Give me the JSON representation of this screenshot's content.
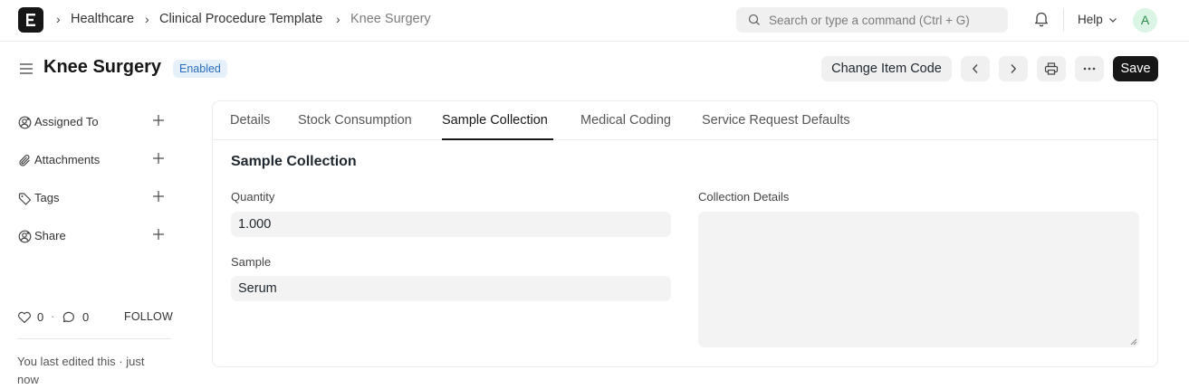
{
  "navbar": {
    "breadcrumbs": [
      "Healthcare",
      "Clinical Procedure Template",
      "Knee Surgery"
    ],
    "search_placeholder": "Search or type a command (Ctrl + G)",
    "help_label": "Help",
    "avatar_initial": "A"
  },
  "page": {
    "title": "Knee Surgery",
    "status": "Enabled",
    "change_item_code_label": "Change Item Code",
    "save_label": "Save"
  },
  "sidebar": {
    "items": [
      {
        "label": "Assigned To",
        "icon": "user-plus-icon"
      },
      {
        "label": "Attachments",
        "icon": "paperclip-icon"
      },
      {
        "label": "Tags",
        "icon": "tag-icon"
      },
      {
        "label": "Share",
        "icon": "share-user-icon"
      }
    ],
    "likes_count": "0",
    "separator": "·",
    "comments_count": "0",
    "follow_label": "FOLLOW",
    "last_edited": "You last edited this · just now"
  },
  "tabs": [
    "Details",
    "Stock Consumption",
    "Sample Collection",
    "Medical Coding",
    "Service Request Defaults"
  ],
  "active_tab": "Sample Collection",
  "form": {
    "section_title": "Sample Collection",
    "quantity_label": "Quantity",
    "quantity_value": "1.000",
    "sample_label": "Sample",
    "sample_value": "Serum",
    "collection_details_label": "Collection Details",
    "collection_details_value": ""
  },
  "colors": {
    "primary_button": "#171717",
    "badge_bg": "#e6f0fb",
    "badge_text": "#2a6ebd",
    "avatar_bg": "#daf5e4"
  }
}
